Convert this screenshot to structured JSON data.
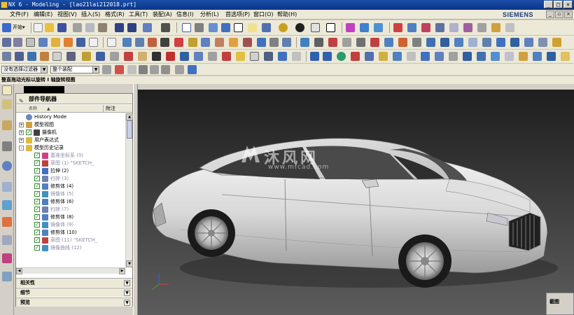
{
  "window": {
    "title": "NX 6 - Modeling - [lao21lai212018.prt]"
  },
  "brand": "SIEMENS",
  "menu": [
    "文件(F)",
    "编辑(E)",
    "视图(V)",
    "插入(S)",
    "格式(R)",
    "工具(T)",
    "装配(A)",
    "信息(I)",
    "分析(L)",
    "首选项(P)",
    "窗口(O)",
    "帮助(H)"
  ],
  "toolbar": {
    "start_label": "开始▾",
    "filter_value": "没有选择过滤器",
    "assembly_scope": "整个装配"
  },
  "status_line": "整直拖动光标以旋转 I 轴旋转视图",
  "navigator": {
    "title": "部件导航器",
    "col_name": "名称",
    "col_sort": "▲",
    "col_note": "附注",
    "items": [
      {
        "label": "History Mode",
        "indent": 0,
        "expander": "",
        "check": false,
        "icon": "clock",
        "dim": false
      },
      {
        "label": "模型视图",
        "indent": 0,
        "expander": "+",
        "check": false,
        "icon": "view",
        "dim": false
      },
      {
        "label": "摄像机",
        "indent": 0,
        "expander": "+",
        "check": true,
        "icon": "camera",
        "dim": false
      },
      {
        "label": "用户表达式",
        "indent": 0,
        "expander": "+",
        "check": false,
        "icon": "folder",
        "dim": false
      },
      {
        "label": "模型历史记录",
        "indent": 0,
        "expander": "-",
        "check": false,
        "icon": "folder",
        "dim": false
      },
      {
        "label": "基准坐标系 (0)",
        "indent": 1,
        "expander": "",
        "check": true,
        "icon": "csys",
        "dim": true
      },
      {
        "label": "草图 (1) \"SKETCH_",
        "indent": 1,
        "expander": "",
        "check": true,
        "icon": "sketch",
        "dim": true
      },
      {
        "label": "拉伸 (2)",
        "indent": 1,
        "expander": "",
        "check": true,
        "icon": "extrude",
        "dim": false
      },
      {
        "label": "扫掠 (3)",
        "indent": 1,
        "expander": "",
        "check": true,
        "icon": "sweep",
        "dim": true
      },
      {
        "label": "修剪体 (4)",
        "indent": 1,
        "expander": "",
        "check": true,
        "icon": "trim",
        "dim": false
      },
      {
        "label": "镜像体 (5)",
        "indent": 1,
        "expander": "",
        "check": true,
        "icon": "mirror",
        "dim": true
      },
      {
        "label": "修剪体 (6)",
        "indent": 1,
        "expander": "",
        "check": true,
        "icon": "trim",
        "dim": false
      },
      {
        "label": "扫掠 (7)",
        "indent": 1,
        "expander": "",
        "check": true,
        "icon": "sweep",
        "dim": true
      },
      {
        "label": "修剪体 (8)",
        "indent": 1,
        "expander": "",
        "check": true,
        "icon": "trim",
        "dim": false
      },
      {
        "label": "镜像体 (9)",
        "indent": 1,
        "expander": "",
        "check": true,
        "icon": "mirror",
        "dim": true
      },
      {
        "label": "修剪体 (10)",
        "indent": 1,
        "expander": "",
        "check": true,
        "icon": "trim",
        "dim": false
      },
      {
        "label": "草图 (11) \"SKETCH_",
        "indent": 1,
        "expander": "",
        "check": true,
        "icon": "sketch",
        "dim": true
      },
      {
        "label": "镜像曲线 (12)",
        "indent": 1,
        "expander": "",
        "check": true,
        "icon": "mirror",
        "dim": true
      }
    ],
    "panels": [
      "相关性",
      "细节",
      "预览"
    ]
  },
  "viewport": {
    "watermark_main": "沐风网",
    "watermark_url": "www.mfcad.com"
  },
  "corner_label": "截图"
}
